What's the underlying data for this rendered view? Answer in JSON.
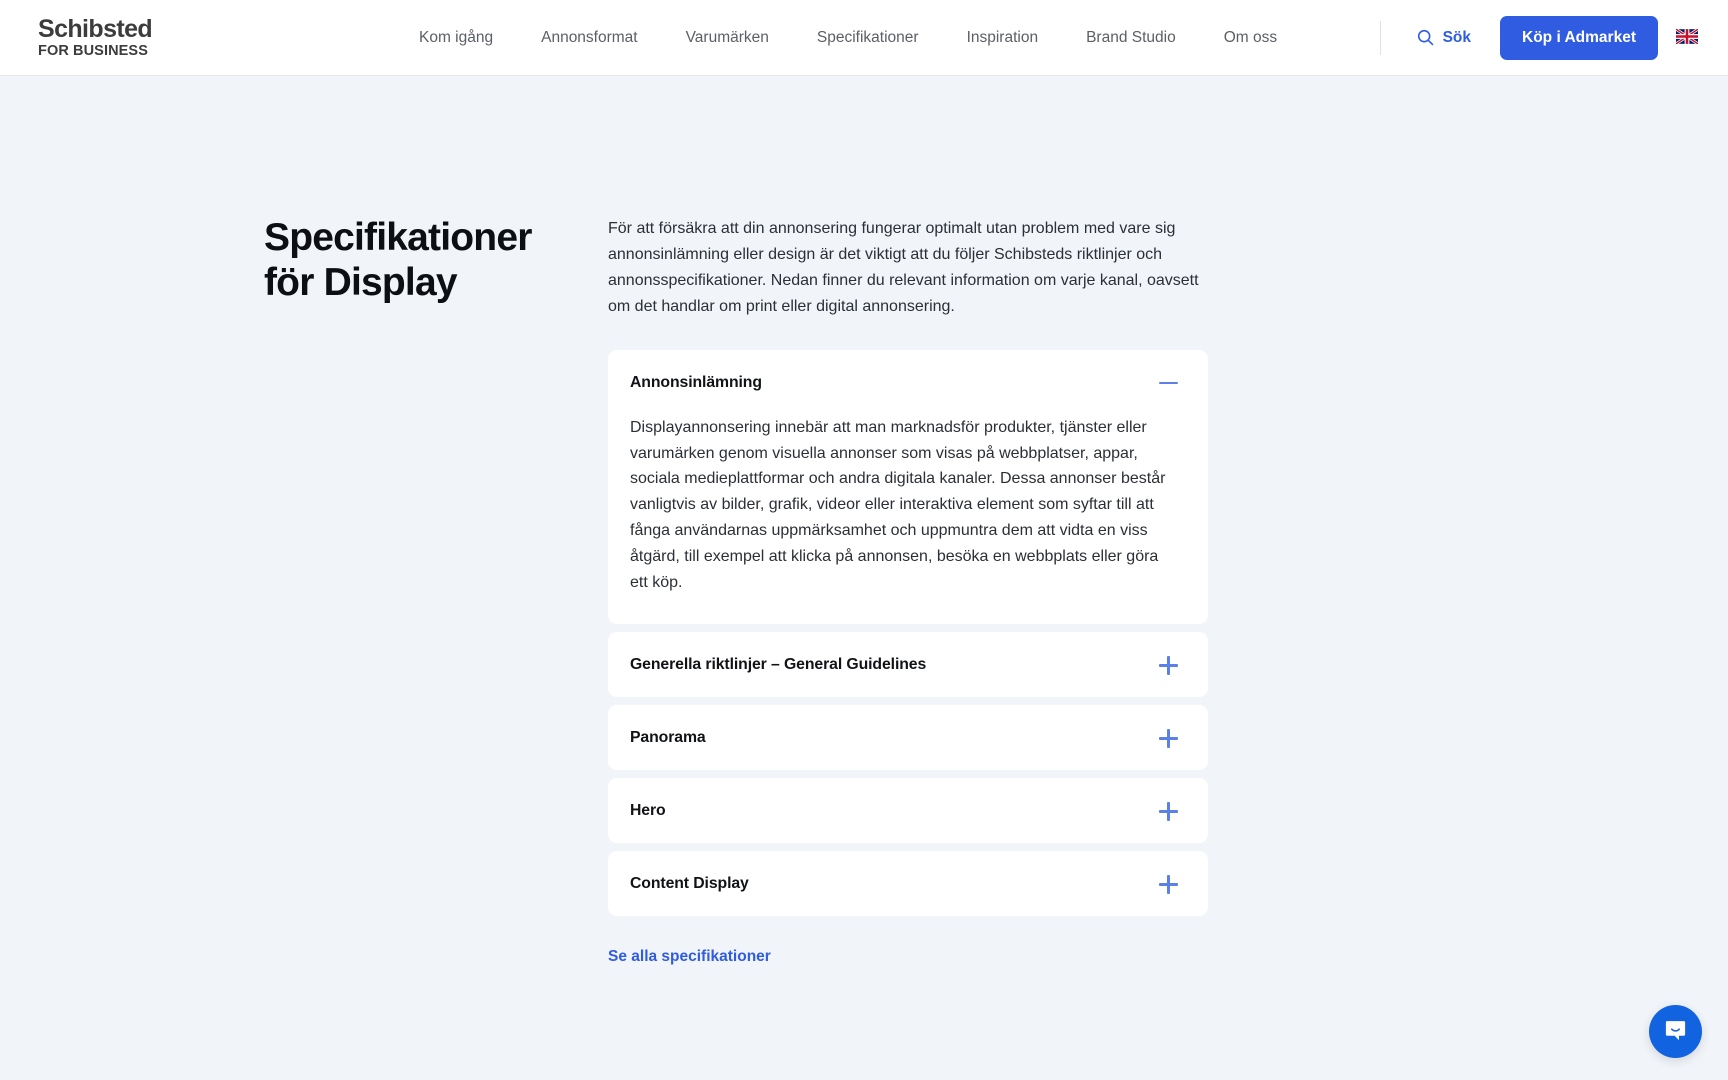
{
  "header": {
    "brand": {
      "line1": "Schibsted",
      "line2": "FOR BUSINESS"
    },
    "nav": [
      {
        "label": "Kom igång"
      },
      {
        "label": "Annonsformat"
      },
      {
        "label": "Varumärken"
      },
      {
        "label": "Specifikationer"
      },
      {
        "label": "Inspiration"
      },
      {
        "label": "Brand Studio"
      },
      {
        "label": "Om oss"
      }
    ],
    "search_label": "Sök",
    "search_icon": "search-icon",
    "cta_label": "Köp i Admarket",
    "language_icon": "uk-flag-icon",
    "accent_color": "#2f5ce0"
  },
  "main": {
    "title": "Specifikationer för Display",
    "intro": "För att försäkra att din annonsering fungerar optimalt utan problem med vare sig annonsinlämning eller design är det viktigt att du följer Schibsteds riktlinjer och annonsspecifikationer. Nedan finner du relevant information om varje kanal, oavsett om det handlar om print eller digital annonsering.",
    "accordion": [
      {
        "title": "Annonsinlämning",
        "expanded": true,
        "icon": "minus-icon",
        "body": "Displayannonsering innebär att man marknadsför produkter, tjänster eller varumärken genom visuella annonser som visas på webbplatser, appar, sociala medieplattformar och andra digitala kanaler. Dessa annonser består vanligtvis av bilder, grafik, videor eller interaktiva element som syftar till att fånga användarnas uppmärksamhet och uppmuntra dem att vidta en viss åtgärd, till exempel att klicka på annonsen, besöka en webbplats eller göra ett köp."
      },
      {
        "title": "Generella riktlinjer – General Guidelines",
        "expanded": false,
        "icon": "plus-icon",
        "body": ""
      },
      {
        "title": "Panorama",
        "expanded": false,
        "icon": "plus-icon",
        "body": ""
      },
      {
        "title": "Hero",
        "expanded": false,
        "icon": "plus-icon",
        "body": ""
      },
      {
        "title": "Content Display",
        "expanded": false,
        "icon": "plus-icon",
        "body": ""
      }
    ],
    "see_all_label": "Se alla specifikationer"
  },
  "chat": {
    "icon": "chat-bubble-icon",
    "color": "#1263e0"
  },
  "colors": {
    "page_background": "#f1f4f9",
    "card_background": "#ffffff",
    "accent_blue": "#2f5ce0",
    "icon_blue": "#5b80e8",
    "body_text": "#2b2f36"
  }
}
